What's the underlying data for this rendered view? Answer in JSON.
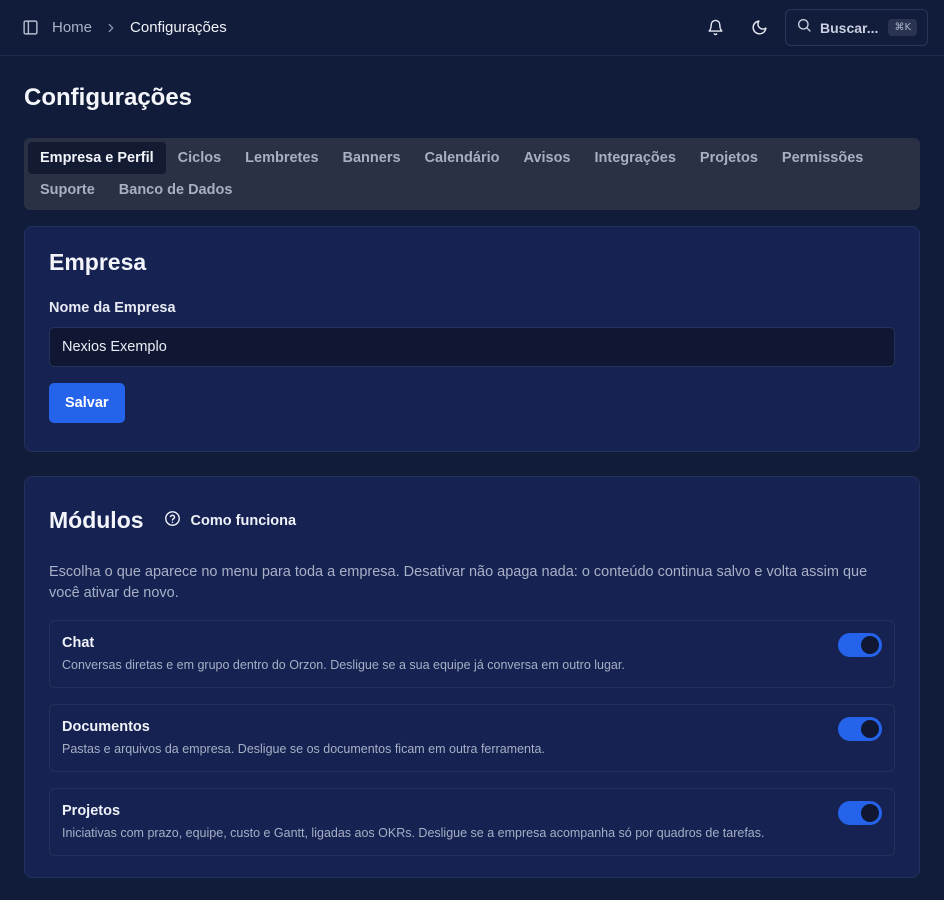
{
  "header": {
    "breadcrumb_home": "Home",
    "breadcrumb_current": "Configurações",
    "search_label": "Buscar...",
    "search_shortcut": "⌘K"
  },
  "page": {
    "title": "Configurações"
  },
  "tabs": [
    {
      "label": "Empresa e Perfil",
      "active": true
    },
    {
      "label": "Ciclos"
    },
    {
      "label": "Lembretes"
    },
    {
      "label": "Banners"
    },
    {
      "label": "Calendário"
    },
    {
      "label": "Avisos"
    },
    {
      "label": "Integrações"
    },
    {
      "label": "Projetos"
    },
    {
      "label": "Permissões"
    },
    {
      "label": "Suporte"
    },
    {
      "label": "Banco de Dados"
    }
  ],
  "empresa": {
    "title": "Empresa",
    "field_label": "Nome da Empresa",
    "field_value": "Nexios Exemplo",
    "save_label": "Salvar"
  },
  "modulos": {
    "title": "Módulos",
    "how_label": "Como funciona",
    "description": "Escolha o que aparece no menu para toda a empresa. Desativar não apaga nada: o conteúdo continua salvo e volta assim que você ativar de novo.",
    "items": [
      {
        "name": "Chat",
        "desc": "Conversas diretas e em grupo dentro do Orzon. Desligue se a sua equipe já conversa em outro lugar.",
        "enabled": true
      },
      {
        "name": "Documentos",
        "desc": "Pastas e arquivos da empresa. Desligue se os documentos ficam em outra ferramenta.",
        "enabled": true
      },
      {
        "name": "Projetos",
        "desc": "Iniciativas com prazo, equipe, custo e Gantt, ligadas aos OKRs. Desligue se a empresa acompanha só por quadros de tarefas.",
        "enabled": true
      }
    ]
  },
  "colors": {
    "accent": "#2563eb",
    "background": "#111c3a",
    "card": "#152252"
  }
}
